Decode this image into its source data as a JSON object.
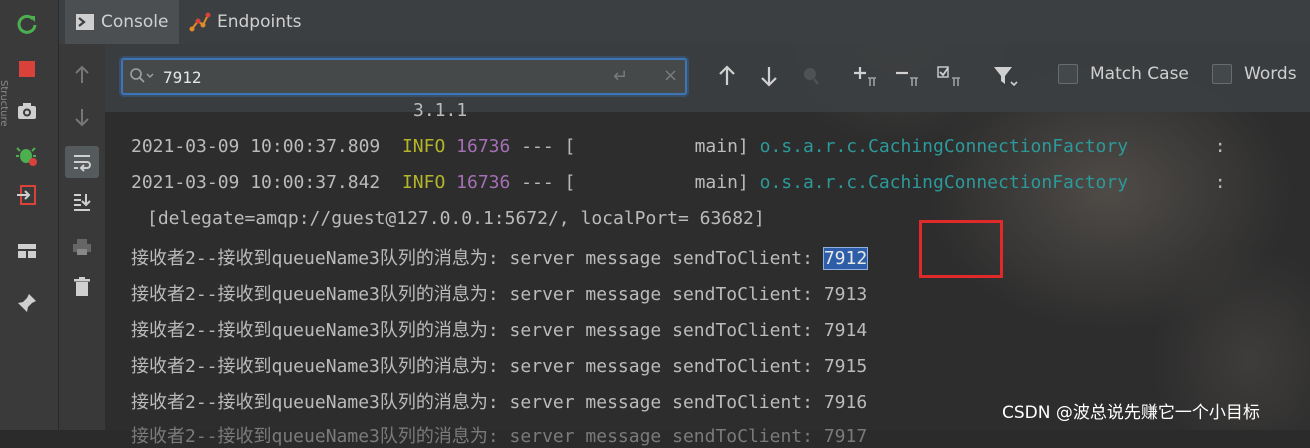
{
  "tabs": [
    {
      "label": "Console",
      "icon": "console-icon",
      "active": true
    },
    {
      "label": "Endpoints",
      "icon": "endpoints-icon",
      "active": false
    }
  ],
  "left_rail": {
    "side_label": "Structure",
    "icons": [
      "rerun-icon",
      "stop-icon",
      "camera-icon",
      "debug-icon",
      "exit-icon",
      "layout-icon",
      "pin-icon"
    ]
  },
  "console_rail": {
    "icons": [
      "arrow-up-icon",
      "arrow-down-icon",
      "soft-wrap-icon",
      "scroll-to-end-icon",
      "print-icon",
      "trash-icon"
    ]
  },
  "search": {
    "value": "7912",
    "enter_glyph": "↵",
    "clear_glyph": "×",
    "options": [
      {
        "label": "Match Case",
        "checked": false
      },
      {
        "label": "Words",
        "checked": false
      }
    ],
    "toolbar_icons": [
      "prev-occurrence-icon",
      "next-occurrence-icon",
      "find-all-icon",
      "add-selection-icon",
      "remove-selection-icon",
      "select-all-icon",
      "filter-icon"
    ]
  },
  "console": {
    "top_partial": "3.1.1",
    "log_lines": [
      {
        "timestamp": "2021-03-09 10:00:37.809",
        "level": "INFO",
        "pid": "16736",
        "sep": "--- [",
        "thread": "main]",
        "logger": "o.s.a.r.c.CachingConnectionFactory",
        "tail": ":"
      },
      {
        "timestamp": "2021-03-09 10:00:37.842",
        "level": "INFO",
        "pid": "16736",
        "sep": "--- [",
        "thread": "main]",
        "logger": "o.s.a.r.c.CachingConnectionFactory",
        "tail": ":"
      }
    ],
    "delegate_line": "[delegate=amqp://guest@127.0.0.1:5672/, localPort= 63682]",
    "message_prefix": "接收者2--接收到queueName3队列的消息为: server message sendToClient: ",
    "messages": [
      "7912",
      "7913",
      "7914",
      "7915",
      "7916"
    ],
    "partial_bottom": "接收者2--接收到queueName3队列的消息为: server message sendToClient: 7917",
    "highlight_value": "7912"
  },
  "watermark": "CSDN @波总说先赚它一个小目标",
  "colors": {
    "info": "#b5b52a",
    "pid": "#a46fb4",
    "logger": "#2c9a9a",
    "highlight_box": "#e02a2a",
    "search_border": "#3d74b5"
  }
}
